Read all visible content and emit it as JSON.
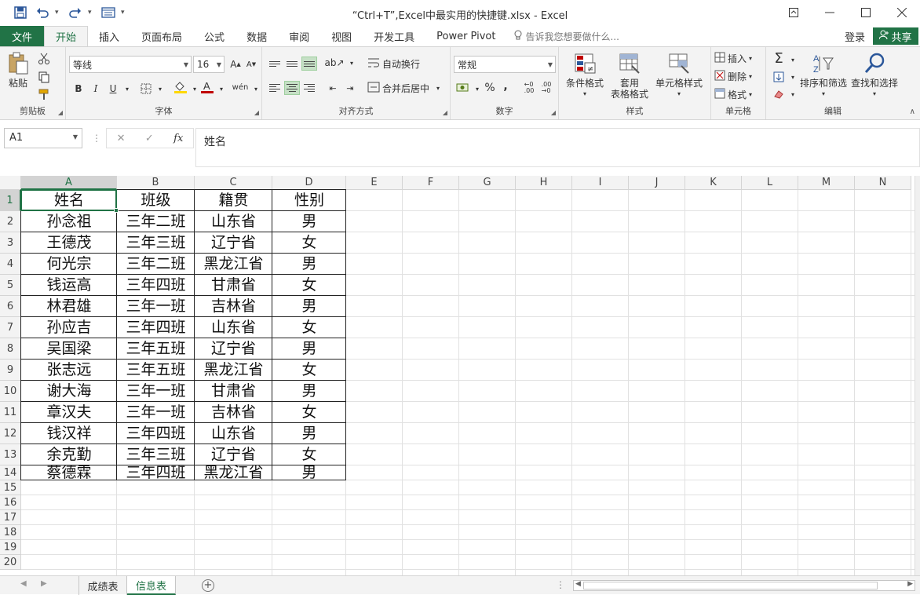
{
  "window": {
    "title": "“Ctrl+T”,Excel中最实用的快捷键.xlsx - Excel"
  },
  "tabs": [
    "文件",
    "开始",
    "插入",
    "页面布局",
    "公式",
    "数据",
    "审阅",
    "视图",
    "开发工具",
    "Power Pivot"
  ],
  "active_tab": "开始",
  "tell_me": "告诉我您想要做什么...",
  "signin": "登录",
  "share": "共享",
  "ribbon": {
    "clipboard": {
      "paste": "粘贴",
      "label": "剪贴板"
    },
    "font": {
      "name": "等线",
      "size": "16",
      "label": "字体",
      "bold": "B",
      "italic": "I",
      "underline": "U",
      "phonetic": "wén"
    },
    "alignment": {
      "wrap": "自动换行",
      "merge": "合并后居中",
      "label": "对齐方式"
    },
    "number": {
      "format": "常规",
      "label": "数字",
      "percent": "%",
      "comma": ","
    },
    "styles": {
      "conditional": "条件格式",
      "table_line1": "套用",
      "table_line2": "表格格式",
      "cell_styles": "单元格样式",
      "label": "样式"
    },
    "cells": {
      "insert": "插入",
      "delete": "删除",
      "format": "格式",
      "label": "单元格"
    },
    "editing": {
      "sort": "排序和筛选",
      "find": "查找和选择",
      "label": "编辑"
    }
  },
  "formula_bar": {
    "name_box": "A1",
    "content": "姓名",
    "fx": "fx"
  },
  "columns": [
    "A",
    "B",
    "C",
    "D",
    "E",
    "F",
    "G",
    "H",
    "I",
    "J",
    "K",
    "L",
    "M",
    "N"
  ],
  "rows": [
    "1",
    "2",
    "3",
    "4",
    "5",
    "6",
    "7",
    "8",
    "9",
    "10",
    "11",
    "12",
    "13",
    "14",
    "15",
    "16",
    "17",
    "18",
    "19",
    "20"
  ],
  "table": {
    "headers": [
      "姓名",
      "班级",
      "籍贯",
      "性别"
    ],
    "rows": [
      [
        "孙念祖",
        "三年二班",
        "山东省",
        "男"
      ],
      [
        "王德茂",
        "三年三班",
        "辽宁省",
        "女"
      ],
      [
        "何光宗",
        "三年二班",
        "黑龙江省",
        "男"
      ],
      [
        "钱运高",
        "三年四班",
        "甘肃省",
        "女"
      ],
      [
        "林君雄",
        "三年一班",
        "吉林省",
        "男"
      ],
      [
        "孙应吉",
        "三年四班",
        "山东省",
        "女"
      ],
      [
        "吴国梁",
        "三年五班",
        "辽宁省",
        "男"
      ],
      [
        "张志远",
        "三年五班",
        "黑龙江省",
        "女"
      ],
      [
        "谢大海",
        "三年一班",
        "甘肃省",
        "男"
      ],
      [
        "章汉夫",
        "三年一班",
        "吉林省",
        "女"
      ],
      [
        "钱汉祥",
        "三年四班",
        "山东省",
        "男"
      ],
      [
        "余克勤",
        "三年三班",
        "辽宁省",
        "女"
      ],
      [
        "蔡德霖",
        "三年四班",
        "黑龙江省",
        "男"
      ]
    ]
  },
  "sheets": [
    "成绩表",
    "信息表"
  ],
  "active_sheet": "信息表",
  "colors": {
    "accent": "#217346",
    "ribbon_bg": "#f3f3f3"
  }
}
